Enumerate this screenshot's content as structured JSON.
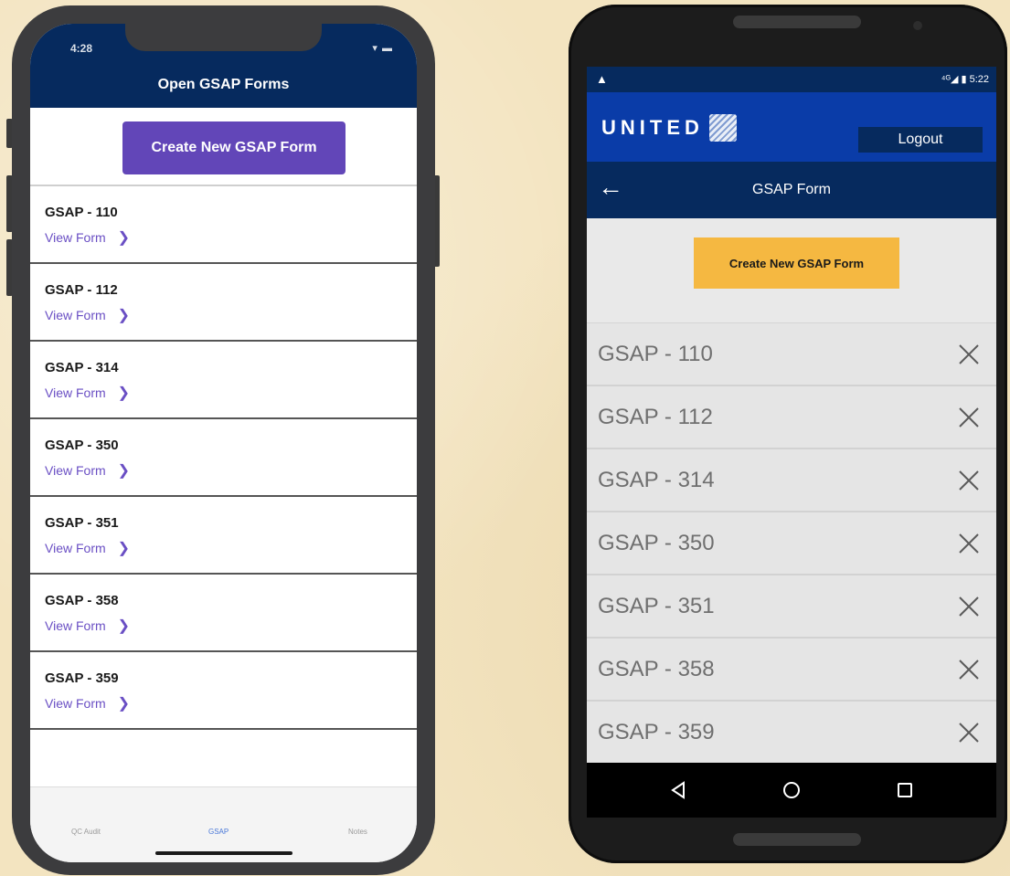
{
  "ios": {
    "status_time": "4:28",
    "status_icons": "▾ ▬",
    "title": "Open GSAP Forms",
    "create_button": "Create New GSAP Form",
    "forms": [
      {
        "title": "GSAP - 110",
        "link": "View Form"
      },
      {
        "title": "GSAP - 112",
        "link": "View Form"
      },
      {
        "title": "GSAP - 314",
        "link": "View Form"
      },
      {
        "title": "GSAP - 350",
        "link": "View Form"
      },
      {
        "title": "GSAP - 351",
        "link": "View Form"
      },
      {
        "title": "GSAP - 358",
        "link": "View Form"
      },
      {
        "title": "GSAP - 359",
        "link": "View Form"
      }
    ],
    "tabs": [
      {
        "label": "QC Audit",
        "active": false
      },
      {
        "label": "GSAP",
        "active": true
      },
      {
        "label": "Notes",
        "active": false
      }
    ],
    "colors": {
      "header": "#062a5e",
      "accent": "#6246b8",
      "link": "#6a4fc4",
      "active_tab": "#4a78d8"
    }
  },
  "android": {
    "status_warning": "▲",
    "status_right": "⁴ᴳ◢ ▮ 5:22",
    "brand": "UNITED",
    "logout": "Logout",
    "subtitle": "GSAP Form",
    "create_button": "Create New GSAP Form",
    "forms": [
      {
        "title": "GSAP - 110"
      },
      {
        "title": "GSAP - 112"
      },
      {
        "title": "GSAP - 314"
      },
      {
        "title": "GSAP - 350"
      },
      {
        "title": "GSAP - 351"
      },
      {
        "title": "GSAP - 358"
      },
      {
        "title": "GSAP - 359"
      }
    ],
    "icons": {
      "back": "arrow-left-icon",
      "delete": "close-icon",
      "nav": [
        "back-triangle-icon",
        "home-circle-icon",
        "recents-square-icon"
      ]
    },
    "colors": {
      "appbar": "#0a3ca8",
      "header": "#062a5e",
      "accent": "#f5b841"
    }
  }
}
